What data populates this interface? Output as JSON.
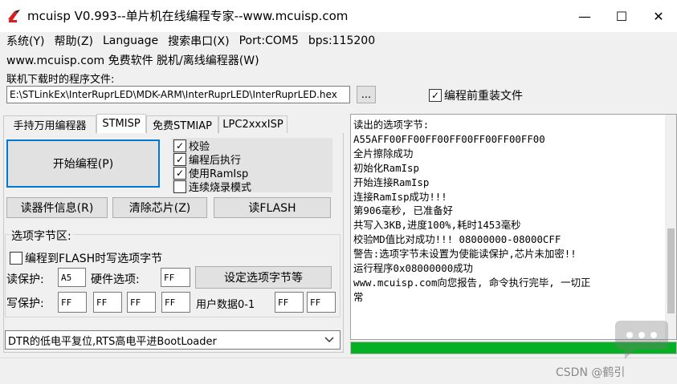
{
  "window": {
    "title": "mcuisp V0.993--单片机在线编程专家--www.mcuisp.com",
    "minimize_glyph": "—",
    "maximize_glyph": "☐",
    "close_glyph": "✕"
  },
  "menu": {
    "items": [
      "系统(Y)",
      "帮助(Z)",
      "Language",
      "搜索串口(X)",
      "Port:COM5",
      "bps:115200"
    ],
    "second_row": "www.mcuisp.com 免费软件 脱机/离线编程器(W)"
  },
  "file": {
    "label": "联机下载时的程序文件:",
    "path": "E:\\STLinkEx\\InterRuprLED\\MDK-ARM\\InterRuprLED\\InterRuprLED.hex",
    "browse_label": "...",
    "reload_label": "编程前重装文件",
    "reload_checked": true
  },
  "tabs": [
    "手持万用编程器",
    "STMISP",
    "免费STMIAP",
    "LPC2xxxISP"
  ],
  "active_tab": 1,
  "program_button": "开始编程(P)",
  "options": [
    {
      "label": "校验",
      "checked": true
    },
    {
      "label": "编程后执行",
      "checked": true
    },
    {
      "label": "使用RamIsp",
      "checked": true
    },
    {
      "label": "连续烧录模式",
      "checked": false
    }
  ],
  "actions": [
    "读器件信息(R)",
    "清除芯片(Z)",
    "读FLASH"
  ],
  "option_bytes": {
    "group_title": "选项字节区:",
    "write_to_flash_label": "编程到FLASH时写选项字节",
    "write_to_flash_checked": false,
    "read_protect_label": "读保护:",
    "read_protect_value": "A5",
    "hw_option_label": "硬件选项:",
    "hw_option_value": "FF",
    "set_button": "设定选项字节等",
    "write_protect_label": "写保护:",
    "write_protect_values": [
      "FF",
      "FF",
      "FF",
      "FF"
    ],
    "user_data_label": "用户数据0-1",
    "user_data_values": [
      "FF",
      "FF"
    ]
  },
  "boot_select": {
    "value": "DTR的低电平复位,RTS高电平进BootLoader"
  },
  "log": {
    "lines": [
      "读出的选项字节:",
      "A55AFF00FF00FF00FF00FF00FF00FF00",
      "全片擦除成功",
      "初始化RamIsp",
      "开始连接RamIsp",
      "连接RamIsp成功!!!",
      "第906毫秒, 已准备好",
      "共写入3KB,进度100%,耗时1453毫秒",
      "校验MD值比对成功!!! 08000000-08000CFF",
      "警告:选项字节未设置为使能读保护,芯片未加密!!",
      "运行程序0x08000000成功",
      "www.mcuisp.com向您报告, 命令执行完毕, 一切正",
      "常"
    ]
  },
  "progress": {
    "fraction": 1.0,
    "color": "#06b025"
  },
  "watermark": "CSDN @鹤引",
  "colors": {
    "accent": "#0078d7",
    "progress": "#06b025"
  }
}
